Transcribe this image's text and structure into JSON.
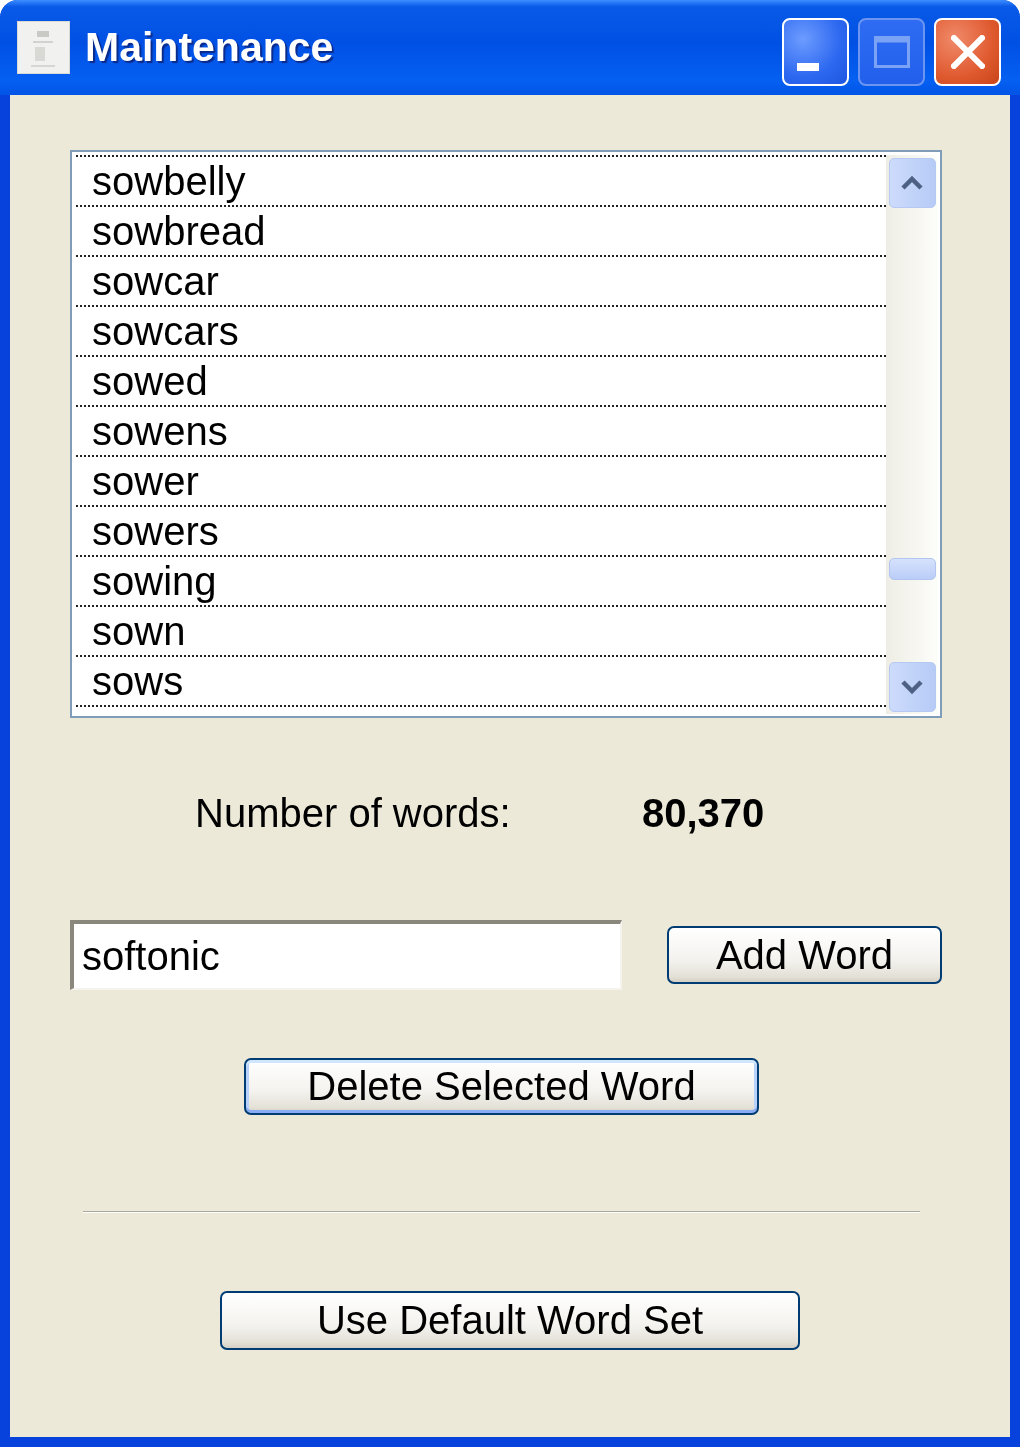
{
  "window": {
    "title": "Maintenance",
    "buttons": [
      {
        "kind": "minimize",
        "disabled": false
      },
      {
        "kind": "maximize",
        "disabled": true
      },
      {
        "kind": "close",
        "disabled": false
      }
    ]
  },
  "word_list": {
    "items": [
      {
        "text": "sowbelly",
        "selected": false
      },
      {
        "text": "sowbread",
        "selected": false
      },
      {
        "text": "sowcar",
        "selected": false
      },
      {
        "text": "sowcars",
        "selected": false
      },
      {
        "text": "sowed",
        "selected": false
      },
      {
        "text": "sowens",
        "selected": false
      },
      {
        "text": "sower",
        "selected": false
      },
      {
        "text": "sowers",
        "selected": false
      },
      {
        "text": "sowing",
        "selected": false
      },
      {
        "text": "sown",
        "selected": false
      },
      {
        "text": "sows",
        "selected": false
      }
    ]
  },
  "word_count": {
    "label": "Number of words:",
    "value": "80,370"
  },
  "new_word": {
    "value": "softonic"
  },
  "add_button": {
    "label": "Add Word",
    "focused": false
  },
  "delete_button": {
    "label": "Delete Selected Word",
    "focused": true
  },
  "default_button": {
    "label": "Use Default Word Set",
    "focused": false
  }
}
